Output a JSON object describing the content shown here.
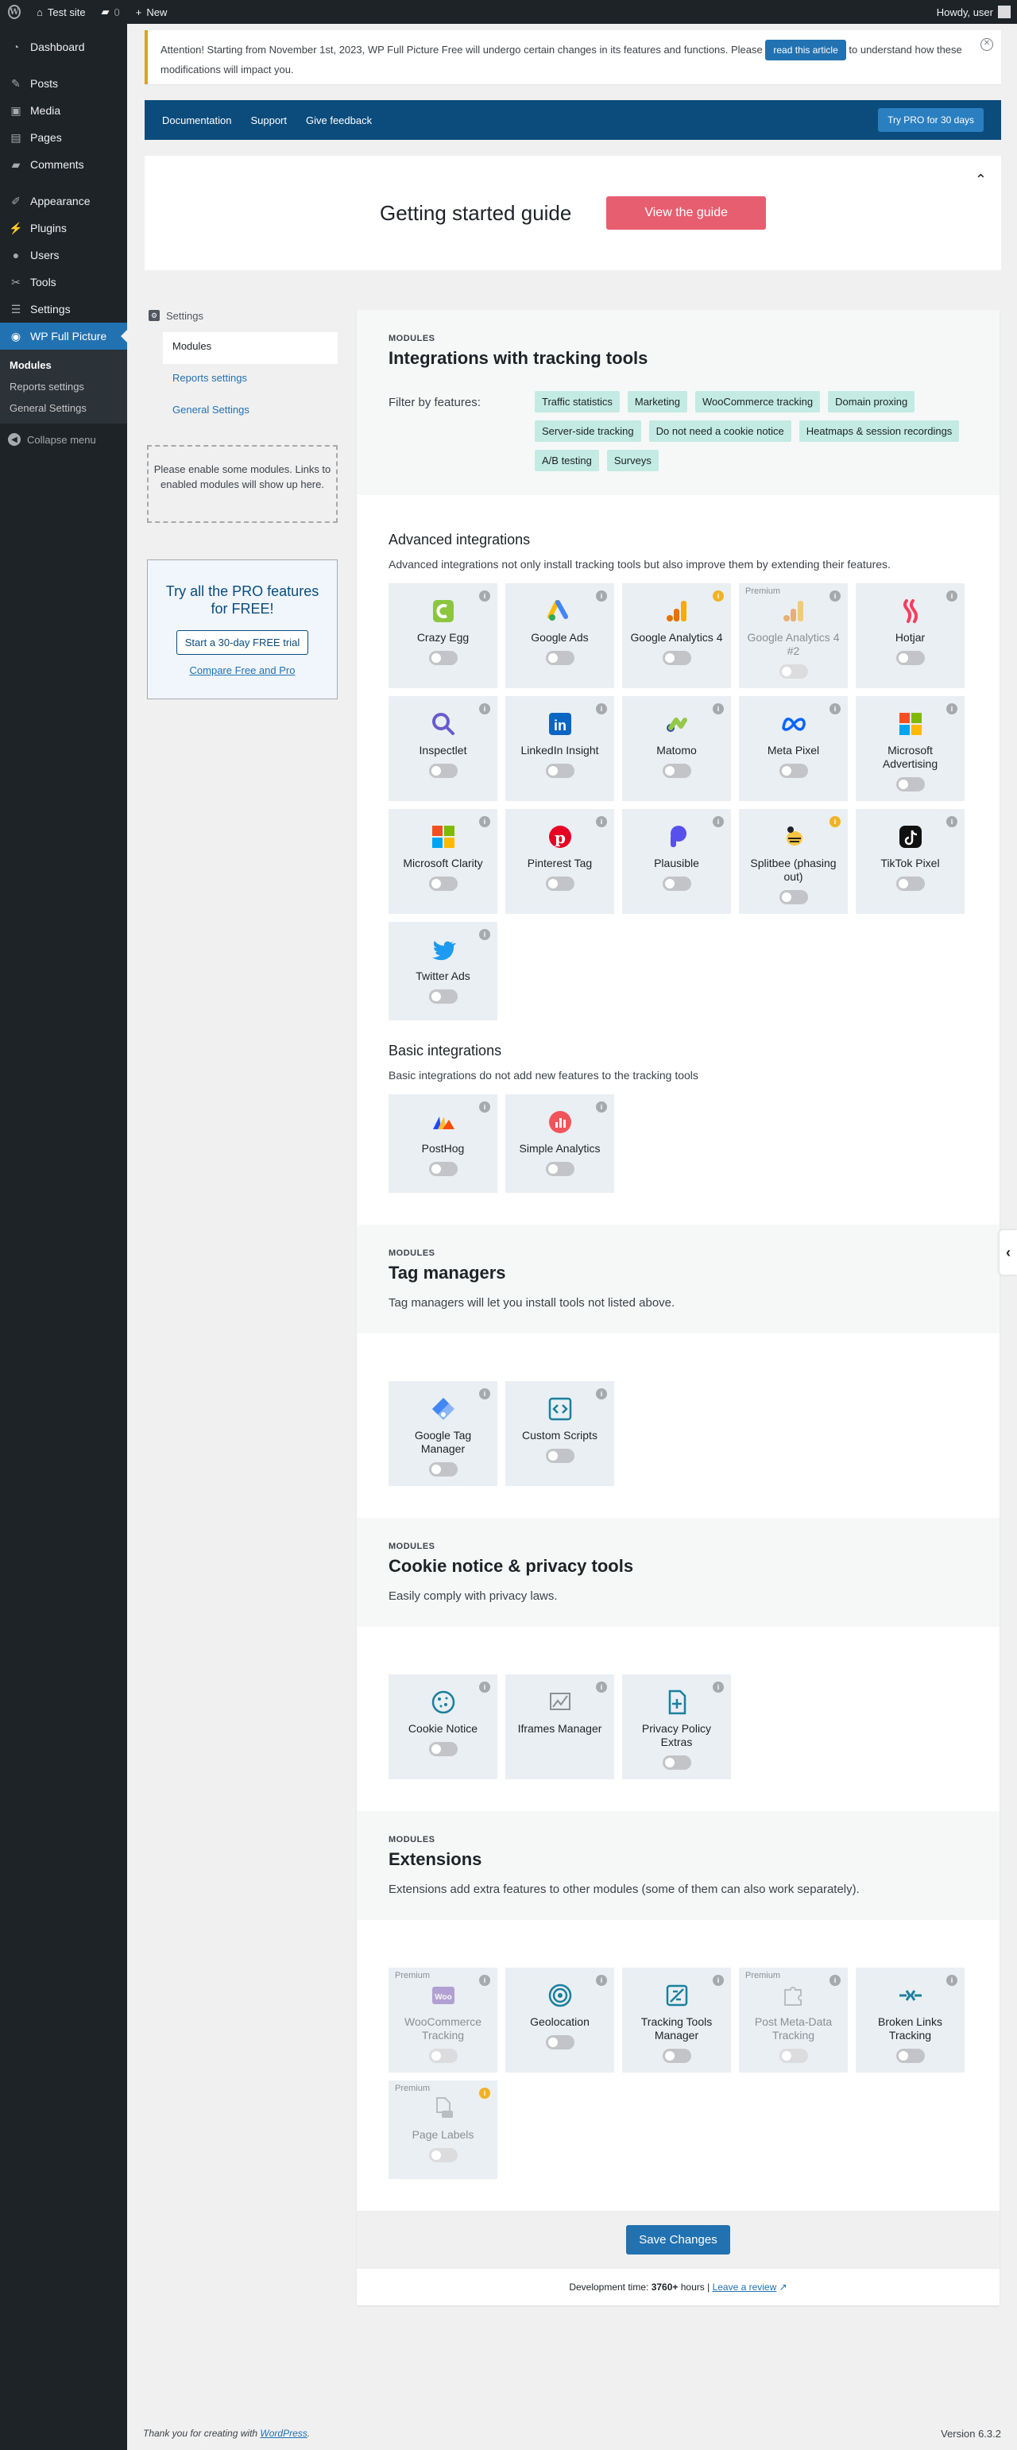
{
  "adminbar": {
    "site_name": "Test site",
    "comments_count": "0",
    "new_label": "New",
    "howdy": "Howdy, user"
  },
  "sidebar": {
    "items": [
      {
        "label": "Dashboard",
        "icon": "dashboard-icon"
      },
      {
        "label": "Posts",
        "icon": "pin-icon"
      },
      {
        "label": "Media",
        "icon": "media-icon"
      },
      {
        "label": "Pages",
        "icon": "page-icon"
      },
      {
        "label": "Comments",
        "icon": "comment-icon"
      },
      {
        "label": "Appearance",
        "icon": "brush-icon"
      },
      {
        "label": "Plugins",
        "icon": "plug-icon"
      },
      {
        "label": "Users",
        "icon": "user-icon"
      },
      {
        "label": "Tools",
        "icon": "wrench-icon"
      },
      {
        "label": "Settings",
        "icon": "sliders-icon"
      },
      {
        "label": "WP Full Picture",
        "icon": "wpfp-icon"
      }
    ],
    "submenu": [
      "Modules",
      "Reports settings",
      "General Settings"
    ],
    "collapse": "Collapse menu"
  },
  "notice": {
    "text_before": "Attention! Starting from November 1st, 2023, WP Full Picture Free will undergo certain changes in its features and functions. Please",
    "button": "read this article",
    "text_after": "to understand how these modifications will impact you."
  },
  "topnav": {
    "links": [
      "Documentation",
      "Support",
      "Give feedback"
    ],
    "pro_button": "Try PRO for 30 days"
  },
  "guide": {
    "title": "Getting started guide",
    "button": "View the guide"
  },
  "leftnav": {
    "heading": "Settings",
    "items": [
      "Modules",
      "Reports settings",
      "General Settings"
    ],
    "empty_note": "Please enable some modules. Links to enabled modules will show up here.",
    "pro_title": "Try all the PRO features for FREE!",
    "pro_button": "Start a 30-day FREE trial",
    "pro_link": "Compare Free and Pro"
  },
  "sections": {
    "integrations": {
      "kicker": "MODULES",
      "title": "Integrations with tracking tools",
      "filter_label": "Filter by features:",
      "chips": [
        "Traffic statistics",
        "Marketing",
        "WooCommerce tracking",
        "Domain proxing",
        "Server-side tracking",
        "Do not need a cookie notice",
        "Heatmaps & session recordings",
        "A/B testing",
        "Surveys"
      ],
      "advanced_title": "Advanced integrations",
      "advanced_desc": "Advanced integrations not only install tracking tools but also improve them by extending their features.",
      "advanced_tiles": [
        {
          "name": "Crazy Egg",
          "icon": "crazyegg-icon"
        },
        {
          "name": "Google Ads",
          "icon": "google-ads-icon"
        },
        {
          "name": "Google Analytics 4",
          "icon": "ga4-icon"
        },
        {
          "name": "Google Analytics 4 #2",
          "icon": "ga4-icon",
          "badge": "Premium"
        },
        {
          "name": "Hotjar",
          "icon": "hotjar-icon"
        },
        {
          "name": "Inspectlet",
          "icon": "inspectlet-icon"
        },
        {
          "name": "LinkedIn Insight",
          "icon": "linkedin-icon"
        },
        {
          "name": "Matomo",
          "icon": "matomo-icon"
        },
        {
          "name": "Meta Pixel",
          "icon": "meta-icon"
        },
        {
          "name": "Microsoft Advertising",
          "icon": "microsoft-icon"
        },
        {
          "name": "Microsoft Clarity",
          "icon": "microsoft-icon"
        },
        {
          "name": "Pinterest Tag",
          "icon": "pinterest-icon"
        },
        {
          "name": "Plausible",
          "icon": "plausible-icon"
        },
        {
          "name": "Splitbee (phasing out)",
          "icon": "splitbee-icon"
        },
        {
          "name": "TikTok Pixel",
          "icon": "tiktok-icon"
        },
        {
          "name": "Twitter Ads",
          "icon": "twitter-icon"
        }
      ],
      "basic_title": "Basic integrations",
      "basic_desc": "Basic integrations do not add new features to the tracking tools",
      "basic_tiles": [
        {
          "name": "PostHog",
          "icon": "posthog-icon"
        },
        {
          "name": "Simple Analytics",
          "icon": "simple-analytics-icon"
        }
      ]
    },
    "tags": {
      "kicker": "MODULES",
      "title": "Tag managers",
      "desc": "Tag managers will let you install tools not listed above.",
      "tiles": [
        {
          "name": "Google Tag Manager",
          "icon": "gtm-icon"
        },
        {
          "name": "Custom Scripts",
          "icon": "code-icon"
        }
      ]
    },
    "privacy": {
      "kicker": "MODULES",
      "title": "Cookie notice & privacy tools",
      "desc": "Easily comply with privacy laws.",
      "tiles": [
        {
          "name": "Cookie Notice",
          "icon": "cookie-icon"
        },
        {
          "name": "Iframes Manager",
          "icon": "iframe-icon"
        },
        {
          "name": "Privacy Policy Extras",
          "icon": "doc-plus-icon"
        }
      ]
    },
    "extensions": {
      "kicker": "MODULES",
      "title": "Extensions",
      "desc": "Extensions add extra features to other modules (some of them can also work separately).",
      "tiles": [
        {
          "name": "WooCommerce Tracking",
          "icon": "woo-icon",
          "badge": "Premium"
        },
        {
          "name": "Geolocation",
          "icon": "target-icon"
        },
        {
          "name": "Tracking Tools Manager",
          "icon": "tools-manager-icon"
        },
        {
          "name": "Post Meta-Data Tracking",
          "icon": "puzzle-icon",
          "badge": "Premium"
        },
        {
          "name": "Broken Links Tracking",
          "icon": "broken-link-icon"
        },
        {
          "name": "Page Labels",
          "icon": "label-icon",
          "badge": "Premium"
        }
      ]
    }
  },
  "save_button": "Save Changes",
  "devtime": {
    "prefix": "Development time:",
    "hours": "3760+",
    "suffix": "hours |",
    "link": "Leave a review"
  },
  "footer": {
    "thanks_prefix": "Thank you for creating with",
    "thanks_link": "WordPress",
    "version": "Version 6.3.2"
  },
  "colors": {
    "accent": "#2271b1",
    "nav_blue": "#0b4c7c",
    "guide_button": "#e65e6f",
    "chip": "#c3ebe3",
    "tile": "#e9eff3"
  }
}
